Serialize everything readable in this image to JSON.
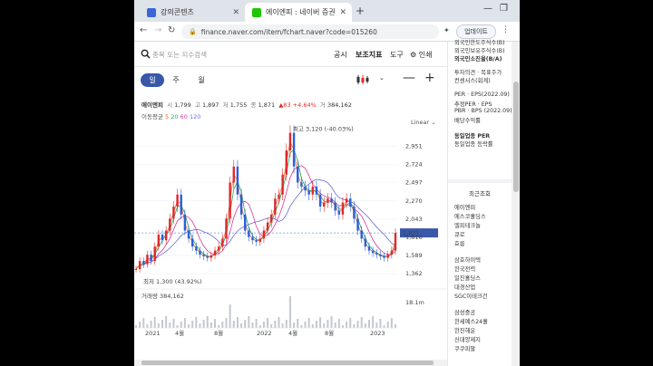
{
  "browser": {
    "tabs": [
      {
        "title": "강의콘텐츠",
        "favicon_color": "#3a66d6",
        "active": false
      },
      {
        "title": "에이엔피 : 네이버 증권",
        "favicon_color": "#1ec800",
        "active": true
      }
    ],
    "url": "finance.naver.com/item/fchart.naver?code=015260",
    "update_label": "업데이트"
  },
  "header": {
    "search_placeholder": "종목 또는 지수검색",
    "menu": [
      "공시",
      "보조지표",
      "도구"
    ],
    "print_label": "인쇄"
  },
  "periods": [
    "일",
    "주",
    "월"
  ],
  "active_period": "일",
  "quote": {
    "name": "에이엔피",
    "open_label": "시",
    "open": "1,799",
    "high_label": "고",
    "high": "1,897",
    "low_label": "저",
    "low": "1,755",
    "close_label": "종",
    "close": "1,871",
    "change": "▲83",
    "change_pct": "+4.64%",
    "volume_label": "거",
    "volume": "384,162"
  },
  "ma": {
    "label": "이동평균",
    "p5": "5",
    "p20": "20",
    "p60": "60",
    "p120": "120"
  },
  "scale_label": "Linear",
  "chart_data": {
    "type": "line",
    "series": [
      {
        "values": [
          1420,
          1520,
          1480,
          1600,
          1520,
          1700,
          1850,
          1780,
          1900,
          2050,
          2200,
          2350,
          2100,
          1900,
          1800,
          1700,
          1650,
          1600,
          1580,
          1560,
          1590,
          1650,
          1700,
          1800,
          2050,
          2500,
          2700,
          2350,
          2100,
          1900,
          1820,
          1780,
          1760,
          1800,
          1900,
          2000,
          2100,
          2300,
          2350,
          2600,
          2900,
          3120,
          2700,
          2500,
          2450,
          2400,
          2350,
          2450,
          2350,
          2200,
          2250,
          2300,
          2250,
          2150,
          2100,
          2250,
          2300,
          2200,
          2050,
          1900,
          1800,
          1700,
          1650,
          1620,
          1600,
          1580,
          1560,
          1600,
          1650,
          1871
        ]
      }
    ],
    "annotations": {
      "max_label": "최고 3,120 (-40.03%)",
      "min_label": "최저 1,300 (43.92%)"
    },
    "ylim": [
      1250,
      3150
    ],
    "y_ticks": [
      "2,951",
      "2,724",
      "2,497",
      "2,270",
      "2,043",
      "1,816",
      "1,589",
      "1,362"
    ],
    "current_price_label": "1,871",
    "x_ticks": [
      "2021",
      "4월",
      "8월",
      "2022",
      "4월",
      "8월",
      "2023"
    ],
    "volume_label": "거래량",
    "volume_value": "384,162",
    "volume_axis_label": "18.1m"
  },
  "sidebar": {
    "items_top": [
      "외국인한도주식수(B)",
      "외국인보유주식수(B)",
      "외국인소진율(B/A)"
    ],
    "items_mid": [
      "투자의견 · 목표주가",
      "컨센서스(회계)"
    ],
    "per_items": [
      "PER · EPS(2022.09)",
      "추정PER · EPS",
      "PBR · BPS (2022.09)",
      "배당수익률"
    ],
    "industry": [
      "동일업종 PER",
      "동일업종 등락률"
    ],
    "recent_title": "최근조회",
    "recent": [
      "에이엔피",
      "에스코홀딩스",
      "엘피테크놀",
      "큐로",
      "효릉"
    ],
    "list2": [
      "삼호하이텍",
      "한국전력",
      "일진홀딩스",
      "대경산업",
      "SGC이테크건"
    ],
    "list3": [
      "삼성중공",
      "한세예스24홀",
      "한진해운",
      "신대양제지",
      "쿠쿠피팔"
    ]
  }
}
